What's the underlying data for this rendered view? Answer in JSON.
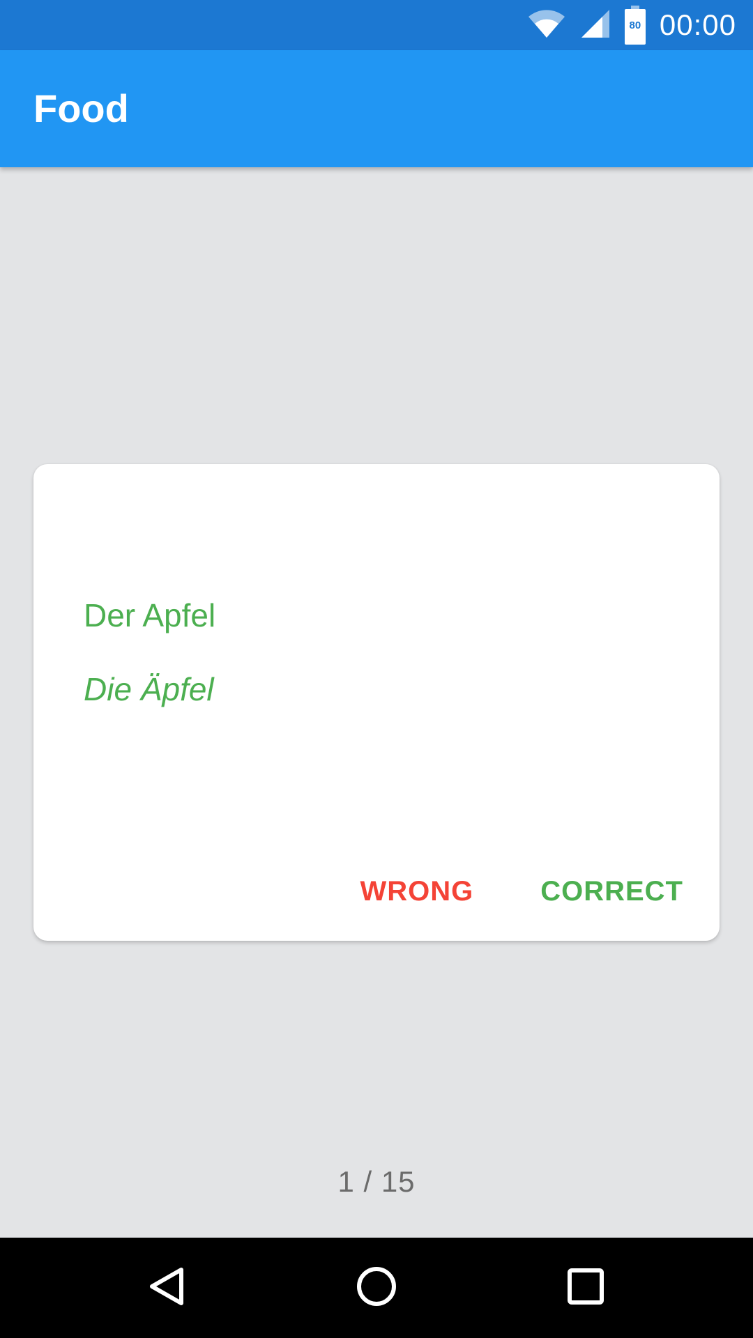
{
  "status_bar": {
    "time": "00:00",
    "battery_level": "80",
    "icons": [
      "wifi-icon",
      "cell-signal-icon",
      "battery-icon"
    ]
  },
  "app_bar": {
    "title": "Food"
  },
  "card": {
    "word_singular": "Der Apfel",
    "word_plural": "Die Äpfel",
    "wrong_label": "WRONG",
    "correct_label": "CORRECT"
  },
  "progress": {
    "text": "1 / 15",
    "current": 1,
    "total": 15
  },
  "nav_bar": {
    "icons": [
      "back-icon",
      "home-icon",
      "recents-icon"
    ]
  },
  "colors": {
    "status_bar": "#1c78d2",
    "app_bar": "#2196f3",
    "background": "#e3e4e6",
    "word_green": "#4caf50",
    "wrong_red": "#f44336",
    "correct_green": "#4caf50"
  }
}
